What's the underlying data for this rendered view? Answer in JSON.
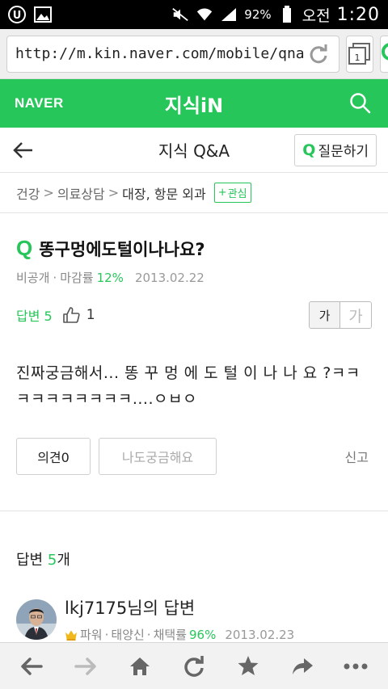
{
  "status_bar": {
    "battery": "92%",
    "ampm": "오전",
    "time": "1:20"
  },
  "browser": {
    "url": "http://m.kin.naver.com/mobile/qna",
    "tab_count": "1"
  },
  "header": {
    "logo": "NAVER",
    "title": "지식iN"
  },
  "subnav": {
    "title": "지식 Q&A",
    "ask_mark": "Q",
    "ask_label": "질문하기"
  },
  "breadcrumb": {
    "items": [
      "건강",
      "의료상담",
      "대장, 항문 외과"
    ],
    "separator": ">",
    "follow_label": "관심",
    "follow_plus": "+"
  },
  "question": {
    "mark": "Q",
    "title": "똥구멍에도털이나나요?",
    "author": "비공개",
    "dot": "·",
    "close_rate_label": "마감률",
    "close_rate_value": "12%",
    "date": "2013.02.22",
    "answer_label": "답변 5",
    "likes": "1",
    "font_small": "가",
    "font_large": "가",
    "body": "진짜궁금해서... 똥 꾸 멍 에 도 털 이 나 나 요 ?ㅋㅋㅋㅋㅋㅋㅋㅋㅋㅋ....ㅇㅂㅇ",
    "opinion_label": "의견0",
    "curious_label": "나도궁금해요",
    "report_label": "신고"
  },
  "answers": {
    "head_label": "답변",
    "head_count": "5",
    "head_unit": "개",
    "items": [
      {
        "name": "lkj7175님의 답변",
        "grade": "파워",
        "rank": "태양신",
        "adopt_label": "채택률",
        "adopt_value": "96%",
        "date": "2013.02.23"
      }
    ]
  },
  "colors": {
    "brand_green": "#27c65a"
  }
}
